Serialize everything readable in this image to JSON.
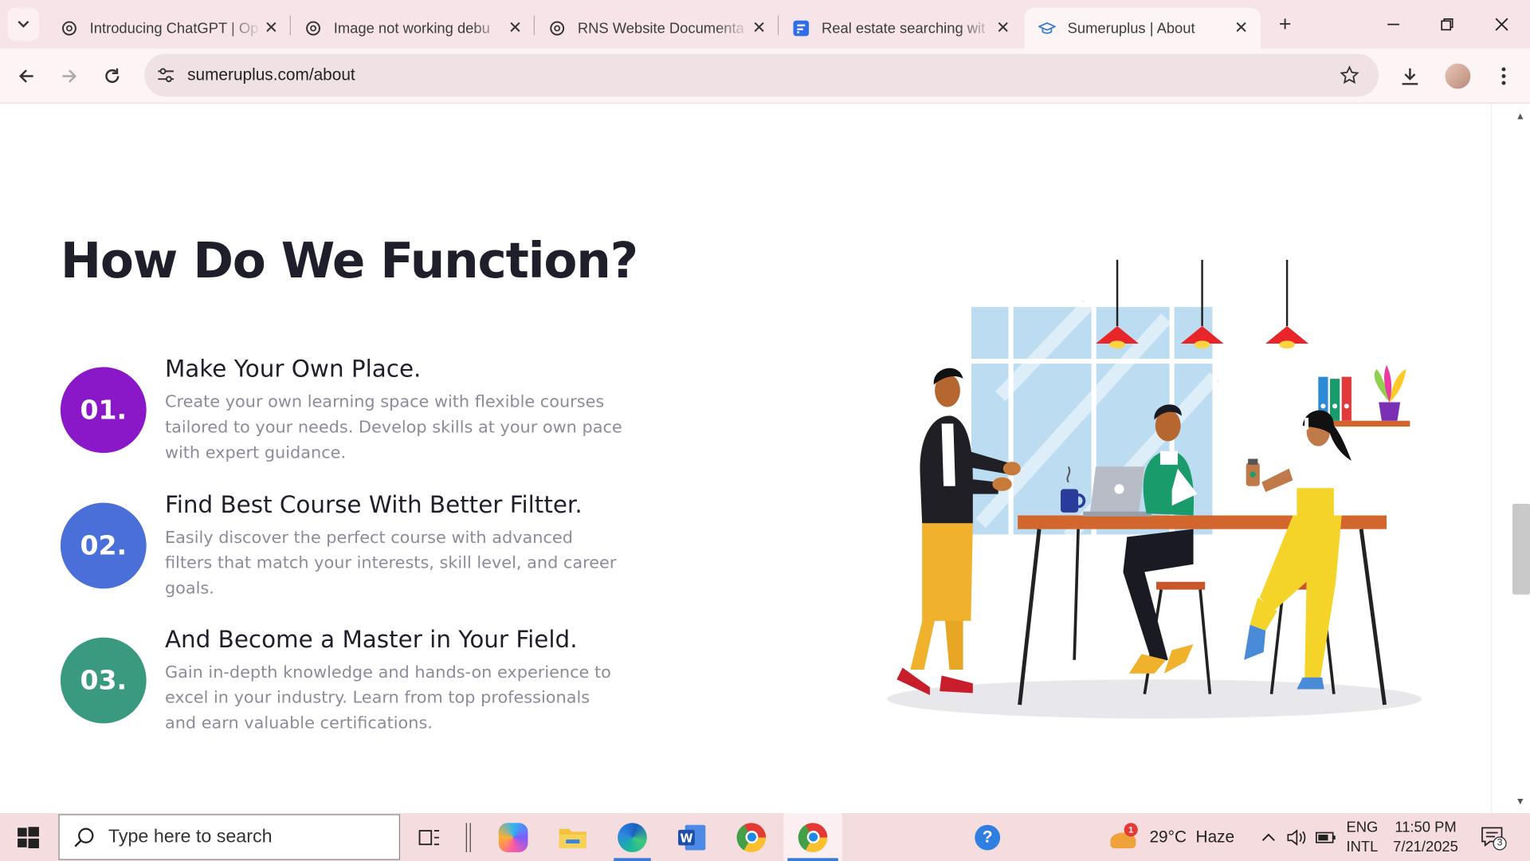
{
  "browser": {
    "tabs": [
      {
        "title": "Introducing ChatGPT | Op",
        "icon": "openai-icon"
      },
      {
        "title": "Image not working debu",
        "icon": "openai-icon"
      },
      {
        "title": "RNS Website Documenta",
        "icon": "openai-icon"
      },
      {
        "title": "Real estate searching wit",
        "icon": "forms-icon"
      },
      {
        "title": "Sumeruplus | About",
        "icon": "graduation-cap-icon",
        "active": true
      }
    ],
    "url": "sumeruplus.com/about"
  },
  "page": {
    "heading": "How Do We Function?",
    "steps": [
      {
        "number": "01.",
        "title": "Make Your Own Place.",
        "description": "Create your own learning space with flexible courses tailored to your needs. Develop skills at your own pace with expert guidance.",
        "color": "#8a17c8"
      },
      {
        "number": "02.",
        "title": "Find Best Course With Better Filtter.",
        "description": "Easily discover the perfect course with advanced filters that match your interests, skill level, and career goals.",
        "color": "#4a6fd8"
      },
      {
        "number": "03.",
        "title": "And Become a Master in Your Field.",
        "description": "Gain in-depth knowledge and hands-on experience to excel in your industry. Learn from top professionals and earn valuable certifications.",
        "color": "#3a9a7f"
      }
    ]
  },
  "taskbar": {
    "search_placeholder": "Type here to search",
    "weather": "29°C  Haze",
    "weather_badge": "1",
    "lang_top": "ENG",
    "lang_bottom": "INTL",
    "time": "11:50 PM",
    "date": "7/21/2025",
    "notifications": "3"
  }
}
